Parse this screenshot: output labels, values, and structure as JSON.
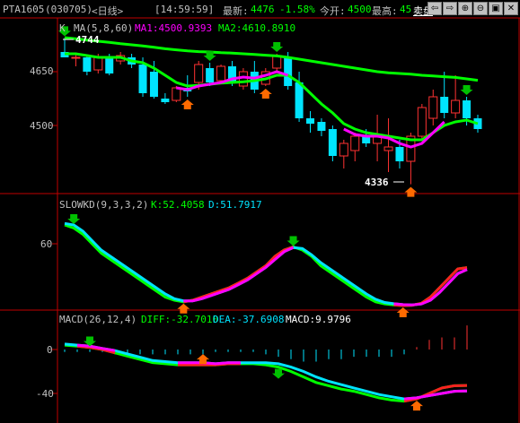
{
  "header": {
    "symbol": "PTA1605",
    "code": "(030705)",
    "period": "<日线>",
    "time": "[14:59:59]",
    "last_label": "最新:",
    "last_value": "4476",
    "change_pct": "-1.58%",
    "open_label": "今开:",
    "open_value": "4500",
    "high_label": "最高:",
    "high_value": "45",
    "sell_link": "卖盘",
    "buttons": [
      "⇦",
      "⇨",
      "⊕",
      "⊖",
      "▣",
      "✕"
    ]
  },
  "panel_kline": {
    "k_label": "K",
    "ma_label": "MA(5,8,60)",
    "ma1_label": "MA1:4500.9393",
    "ma2_label": "MA2:4610.8910",
    "y_ticks": [
      "4650",
      "4500"
    ],
    "high_mark": "4744",
    "low_mark": "4336"
  },
  "panel_kd": {
    "name": "SLOWKD(9,3,3,2)",
    "k_label": "K:52.4058",
    "d_label": "D:51.7917",
    "y_ticks": [
      "60"
    ]
  },
  "panel_macd": {
    "name": "MACD(26,12,4)",
    "diff_label": "DIFF:-32.7010",
    "dea_label": "DEA:-37.6908",
    "macd_label": "MACD:9.9796",
    "y_ticks": [
      "0",
      "-40"
    ]
  },
  "colors": {
    "up": "#ff3232",
    "down": "#00e4ff",
    "ma1": "#ff00ff",
    "ma2": "#00ff00",
    "axis": "#c00000",
    "label": "#c0c0c0"
  },
  "chart_data": [
    {
      "type": "candlestick",
      "title": "K MA(5,8,60)",
      "ylim": [
        4300,
        4800
      ],
      "candles": [
        {
          "o": 4705,
          "h": 4744,
          "l": 4690,
          "c": 4690
        },
        {
          "o": 4690,
          "h": 4700,
          "l": 4665,
          "c": 4690
        },
        {
          "o": 4690,
          "h": 4698,
          "l": 4640,
          "c": 4650
        },
        {
          "o": 4655,
          "h": 4700,
          "l": 4645,
          "c": 4690
        },
        {
          "o": 4690,
          "h": 4700,
          "l": 4640,
          "c": 4645
        },
        {
          "o": 4680,
          "h": 4705,
          "l": 4670,
          "c": 4695
        },
        {
          "o": 4690,
          "h": 4700,
          "l": 4660,
          "c": 4670
        },
        {
          "o": 4670,
          "h": 4690,
          "l": 4580,
          "c": 4590
        },
        {
          "o": 4650,
          "h": 4680,
          "l": 4575,
          "c": 4580
        },
        {
          "o": 4575,
          "h": 4590,
          "l": 4560,
          "c": 4565
        },
        {
          "o": 4570,
          "h": 4610,
          "l": 4565,
          "c": 4605
        },
        {
          "o": 4605,
          "h": 4640,
          "l": 4580,
          "c": 4595
        },
        {
          "o": 4620,
          "h": 4680,
          "l": 4600,
          "c": 4670
        },
        {
          "o": 4660,
          "h": 4675,
          "l": 4610,
          "c": 4620
        },
        {
          "o": 4625,
          "h": 4670,
          "l": 4620,
          "c": 4665
        },
        {
          "o": 4665,
          "h": 4680,
          "l": 4610,
          "c": 4620
        },
        {
          "o": 4610,
          "h": 4660,
          "l": 4600,
          "c": 4650
        },
        {
          "o": 4650,
          "h": 4680,
          "l": 4590,
          "c": 4600
        },
        {
          "o": 4615,
          "h": 4660,
          "l": 4610,
          "c": 4650
        },
        {
          "o": 4660,
          "h": 4700,
          "l": 4650,
          "c": 4695
        },
        {
          "o": 4690,
          "h": 4705,
          "l": 4600,
          "c": 4610
        },
        {
          "o": 4620,
          "h": 4650,
          "l": 4510,
          "c": 4520
        },
        {
          "o": 4520,
          "h": 4540,
          "l": 4480,
          "c": 4505
        },
        {
          "o": 4510,
          "h": 4520,
          "l": 4470,
          "c": 4485
        },
        {
          "o": 4490,
          "h": 4500,
          "l": 4400,
          "c": 4415
        },
        {
          "o": 4415,
          "h": 4460,
          "l": 4380,
          "c": 4450
        },
        {
          "o": 4430,
          "h": 4480,
          "l": 4400,
          "c": 4470
        },
        {
          "o": 4470,
          "h": 4490,
          "l": 4440,
          "c": 4450
        },
        {
          "o": 4450,
          "h": 4530,
          "l": 4400,
          "c": 4470
        },
        {
          "o": 4430,
          "h": 4520,
          "l": 4370,
          "c": 4440
        },
        {
          "o": 4440,
          "h": 4460,
          "l": 4380,
          "c": 4400
        },
        {
          "o": 4400,
          "h": 4480,
          "l": 4336,
          "c": 4470
        },
        {
          "o": 4470,
          "h": 4560,
          "l": 4460,
          "c": 4550
        },
        {
          "o": 4520,
          "h": 4600,
          "l": 4500,
          "c": 4580
        },
        {
          "o": 4580,
          "h": 4650,
          "l": 4520,
          "c": 4535
        },
        {
          "o": 4535,
          "h": 4640,
          "l": 4520,
          "c": 4570
        },
        {
          "o": 4570,
          "h": 4580,
          "l": 4500,
          "c": 4520
        },
        {
          "o": 4520,
          "h": 4530,
          "l": 4480,
          "c": 4490
        }
      ],
      "series": [
        {
          "name": "MA1",
          "values": [
            4700,
            4695,
            4690,
            4688,
            4690,
            4685,
            4675,
            4660,
            4640,
            4620,
            4605,
            4600,
            4610,
            4615,
            4620,
            4630,
            4635,
            4632,
            4640,
            4650,
            4640,
            4610,
            4580,
            4550,
            4520,
            4490,
            4475,
            4470,
            4470,
            4465,
            4450,
            4440,
            4450,
            4480,
            4510,
            4530,
            4525,
            4505
          ]
        },
        {
          "name": "MA2",
          "values": [
            4700,
            4700,
            4695,
            4690,
            4690,
            4690,
            4680,
            4675,
            4660,
            4640,
            4620,
            4610,
            4612,
            4615,
            4618,
            4620,
            4622,
            4625,
            4630,
            4640,
            4640,
            4620,
            4590,
            4560,
            4535,
            4505,
            4490,
            4480,
            4475,
            4470,
            4465,
            4460,
            4460,
            4480,
            4500,
            4510,
            4515,
            4505
          ]
        },
        {
          "name": "MA60",
          "values": [
            4745,
            4742,
            4738,
            4735,
            4732,
            4728,
            4725,
            4722,
            4718,
            4714,
            4711,
            4708,
            4706,
            4705,
            4703,
            4702,
            4700,
            4698,
            4696,
            4694,
            4690,
            4685,
            4680,
            4675,
            4670,
            4665,
            4660,
            4655,
            4650,
            4647,
            4645,
            4643,
            4640,
            4638,
            4636,
            4634,
            4630,
            4626
          ]
        }
      ],
      "ma_color_segments_up": [
        [
          10,
          20
        ],
        [
          25,
          34
        ]
      ],
      "arrows": [
        {
          "i": 0,
          "type": "down"
        },
        {
          "i": 13,
          "type": "down"
        },
        {
          "i": 19,
          "type": "down"
        },
        {
          "i": 36,
          "type": "down"
        },
        {
          "i": 11,
          "type": "up"
        },
        {
          "i": 18,
          "type": "up"
        },
        {
          "i": 31,
          "type": "up"
        }
      ]
    },
    {
      "type": "line",
      "title": "SLOWKD(9,3,3,2)",
      "ylim": [
        40,
        70
      ],
      "series": [
        {
          "name": "K",
          "values": [
            66,
            65,
            63,
            60,
            57,
            55,
            53,
            51,
            49,
            47,
            45,
            43,
            42,
            41.5,
            42,
            43,
            44,
            45,
            46,
            47.5,
            49,
            51,
            53,
            56,
            58,
            59,
            58,
            56,
            53,
            51,
            49,
            47,
            45,
            43,
            41.5,
            40.8,
            40.5,
            40.3,
            40.4,
            41,
            43,
            46,
            49,
            52,
            52.4
          ]
        },
        {
          "name": "D",
          "values": [
            66.5,
            66,
            64,
            61,
            58,
            56,
            54,
            52,
            50,
            48,
            46,
            44,
            42.5,
            41.8,
            41.8,
            42.5,
            43.5,
            44.5,
            45.5,
            47,
            48.5,
            50.5,
            52.5,
            55,
            57.5,
            58.8,
            58.5,
            56.5,
            54,
            52,
            50,
            48,
            46,
            44,
            42.3,
            41.3,
            40.9,
            40.6,
            40.5,
            40.8,
            42,
            44.5,
            47.5,
            50.5,
            51.8
          ]
        }
      ]
    },
    {
      "type": "line",
      "title": "MACD(26,12,4)",
      "ylim": [
        -50,
        20
      ],
      "series": [
        {
          "name": "DIFF",
          "values": [
            4,
            3,
            2,
            0,
            -3,
            -6,
            -9,
            -12,
            -13,
            -14,
            -14,
            -14,
            -14,
            -13,
            -13,
            -13,
            -14,
            -16,
            -20,
            -25,
            -30,
            -33,
            -36,
            -38,
            -41,
            -44,
            -46,
            -47,
            -45,
            -40,
            -35,
            -33,
            -32.7
          ]
        },
        {
          "name": "DEA",
          "values": [
            5,
            4,
            3,
            1,
            -1,
            -4,
            -7,
            -10,
            -11,
            -12,
            -12,
            -12,
            -13,
            -12,
            -12,
            -12,
            -12,
            -13,
            -16,
            -20,
            -25,
            -29,
            -32,
            -35,
            -38,
            -41,
            -43,
            -45,
            -44,
            -42,
            -40,
            -38,
            -37.7
          ]
        },
        {
          "name": "MACD",
          "values": [
            -1,
            -1,
            -1,
            -1,
            -2,
            -2,
            -2,
            -2,
            -2,
            -2,
            -2,
            -2,
            -1,
            -1,
            -1,
            -1,
            -2,
            -3,
            -4,
            -5,
            -5,
            -4,
            -4,
            -3,
            -3,
            -3,
            -3,
            -2,
            1,
            4,
            5,
            5,
            9.98
          ]
        }
      ]
    }
  ]
}
